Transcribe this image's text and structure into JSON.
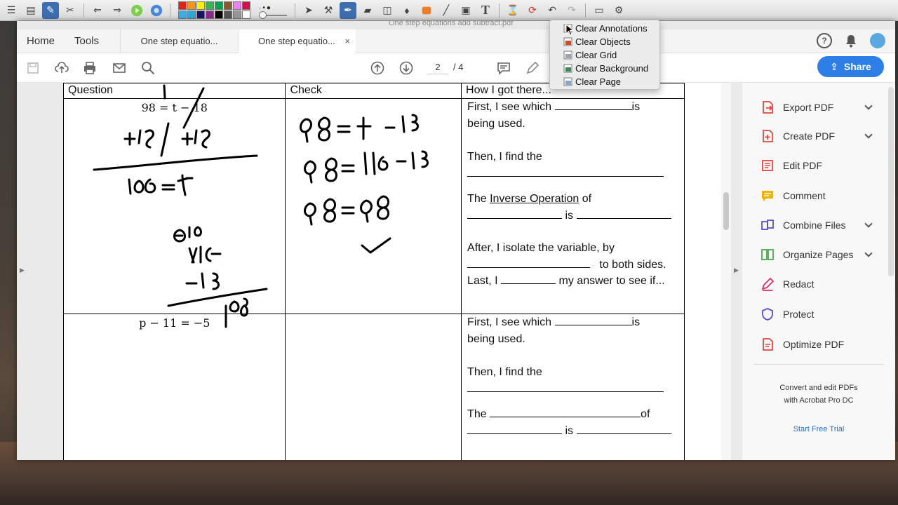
{
  "acrobat": {
    "title_strip_text": "One step equations add subtract.pdf",
    "nav": {
      "home": "Home",
      "tools": "Tools"
    },
    "tabs": [
      {
        "label": "One step equatio..."
      },
      {
        "label": "One step equatio...",
        "close": "×"
      }
    ],
    "toolbar": {
      "page_current": "2",
      "page_total": "/ 4",
      "share_label": "Share"
    },
    "right_panel": {
      "items": [
        {
          "label": "Export PDF",
          "icon": "export-pdf-icon",
          "color": "#e0483e",
          "expandable": true
        },
        {
          "label": "Create PDF",
          "icon": "create-pdf-icon",
          "color": "#e0483e",
          "expandable": true
        },
        {
          "label": "Edit PDF",
          "icon": "edit-pdf-icon",
          "color": "#e0483e",
          "expandable": false
        },
        {
          "label": "Comment",
          "icon": "comment-icon",
          "color": "#f2b300",
          "expandable": false
        },
        {
          "label": "Combine Files",
          "icon": "combine-files-icon",
          "color": "#5a4fcf",
          "expandable": true
        },
        {
          "label": "Organize Pages",
          "icon": "organize-pages-icon",
          "color": "#4aa84a",
          "expandable": true
        },
        {
          "label": "Redact",
          "icon": "redact-icon",
          "color": "#d6336c",
          "expandable": false
        },
        {
          "label": "Protect",
          "icon": "protect-icon",
          "color": "#5a4fcf",
          "expandable": false
        },
        {
          "label": "Optimize PDF",
          "icon": "optimize-pdf-icon",
          "color": "#e0483e",
          "expandable": false
        }
      ],
      "promo_line1": "Convert and edit PDFs",
      "promo_line2": "with Acrobat Pro DC",
      "trial_link": "Start Free Trial"
    }
  },
  "worksheet": {
    "headers": [
      "Question",
      "Check",
      "How I got there..."
    ],
    "rows": [
      {
        "question": "98 = t − 18",
        "how": {
          "l1a": "First, I see which",
          "l1b": "is",
          "l2": "being used.",
          "l3": "Then, I find the",
          "l4a": "The",
          "l4b": "Inverse Operation",
          "l4c": "of",
          "l5": "is",
          "l6": "After, I isolate the variable, by",
          "l7": "to both sides.",
          "l8a": "Last, I",
          "l8b": "my answer to see if..."
        }
      },
      {
        "question": "p − 11 = −5",
        "how": {
          "l1a": "First, I see which",
          "l1b": "is",
          "l2": "being used.",
          "l3": "Then, I find the",
          "l4a": "The",
          "l4c": "of",
          "l5": "is"
        }
      }
    ]
  },
  "dropdown": {
    "items": [
      {
        "label": "Clear Annotations",
        "icon": "clear-annotations-icon"
      },
      {
        "label": "Clear Objects",
        "icon": "clear-objects-icon"
      },
      {
        "label": "Clear Grid",
        "icon": "clear-grid-icon"
      },
      {
        "label": "Clear Background",
        "icon": "clear-background-icon"
      },
      {
        "label": "Clear Page",
        "icon": "clear-page-icon"
      }
    ]
  },
  "palette": [
    "#e2231a",
    "#f7941d",
    "#fff200",
    "#39b54a",
    "#00a651",
    "#8b5a2b",
    "#ee82ee",
    "#d11149",
    "#3ab0e8",
    "#29abe2",
    "#1b1464",
    "#92278f",
    "#000000",
    "#555555",
    "#999999",
    "#ffffff"
  ],
  "accent": "#2d7ee6"
}
